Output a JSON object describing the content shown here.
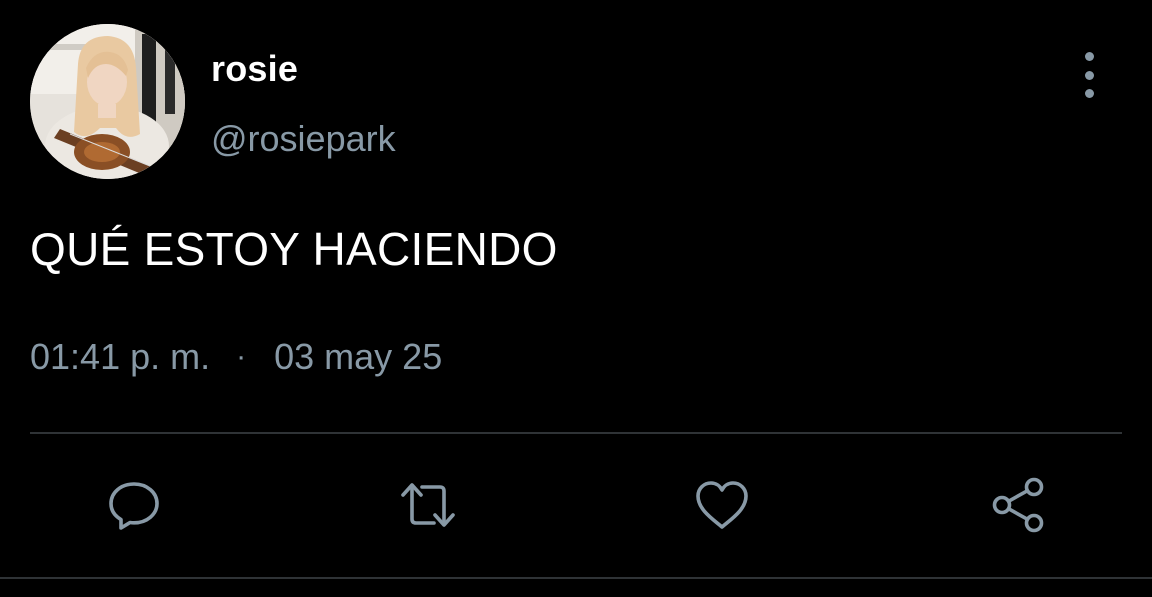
{
  "author": {
    "display_name": "rosie",
    "handle": "@rosiepark",
    "avatar_icon": "profile-photo"
  },
  "tweet": {
    "text": "QUÉ ESTOY HACIENDO",
    "time": "01:41 p. m.",
    "separator": "·",
    "date": "03 may 25"
  },
  "actions": [
    {
      "name": "reply",
      "icon": "speech-bubble-icon"
    },
    {
      "name": "retweet",
      "icon": "retweet-icon"
    },
    {
      "name": "like",
      "icon": "heart-icon"
    },
    {
      "name": "share",
      "icon": "share-icon"
    }
  ],
  "colors": {
    "background": "#000000",
    "primary_text": "#ffffff",
    "secondary_text": "#8899a6",
    "divider": "#2f3336"
  }
}
